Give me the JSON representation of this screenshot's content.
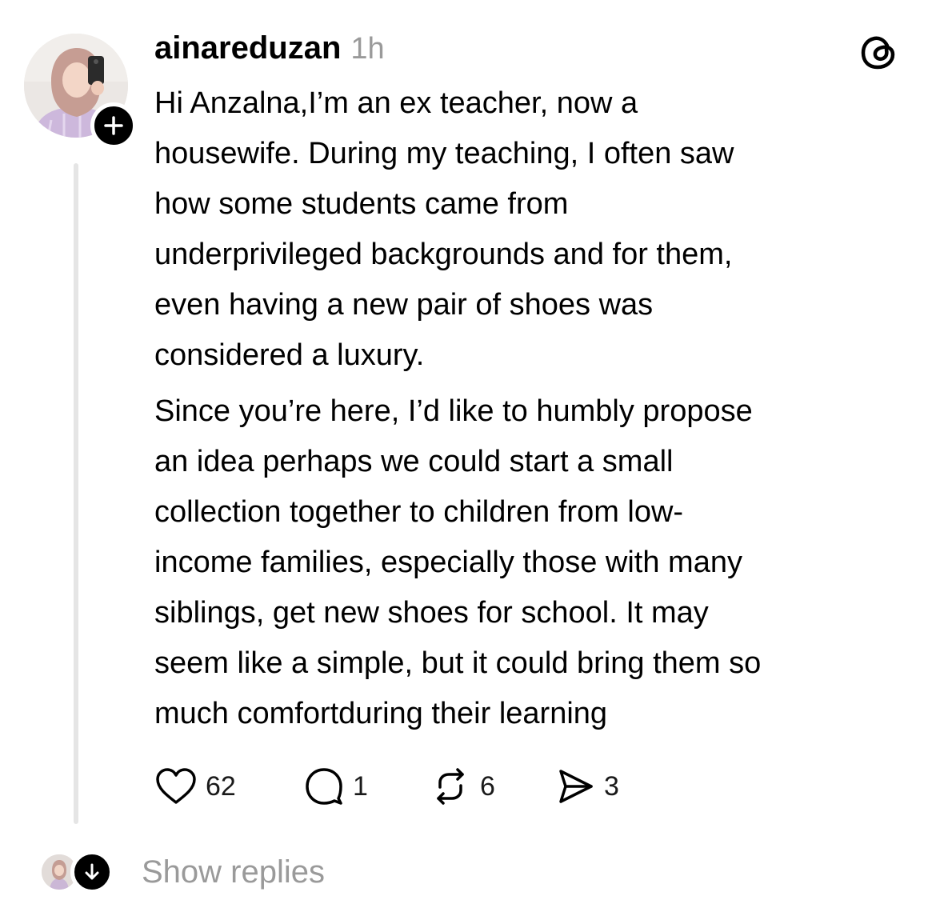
{
  "post": {
    "username": "ainareduzan",
    "timestamp": "1h",
    "paragraphs": [
      [
        "Hi Anzalna,I’m an ex teacher, now a",
        "housewife. During my teaching, I often saw",
        "how some students came from",
        "underprivileged backgrounds and for them,",
        "even having a new pair of shoes was",
        "considered a luxury."
      ],
      [
        "Since you’re here, I’d like to humbly propose",
        "an idea perhaps we could start a small",
        "collection together to children from low-",
        "income families, especially those with many",
        "siblings, get new shoes for school. It may",
        "seem like a simple, but it could bring them so",
        "much comfortduring their learning"
      ]
    ],
    "actions": {
      "likes": "62",
      "replies": "1",
      "reposts": "6",
      "shares": "3"
    }
  },
  "footer": {
    "show_replies_label": "Show replies"
  },
  "icons": {
    "app_logo": "threads-logo-icon",
    "follow": "plus-icon",
    "like": "heart-icon",
    "reply": "comment-bubble-icon",
    "repost": "repost-icon",
    "share": "send-icon",
    "expand": "arrow-down-icon"
  },
  "colors": {
    "text": "#000000",
    "muted": "#9a9a9a",
    "thread_line": "#e5e5e5",
    "badge": "#000000"
  }
}
